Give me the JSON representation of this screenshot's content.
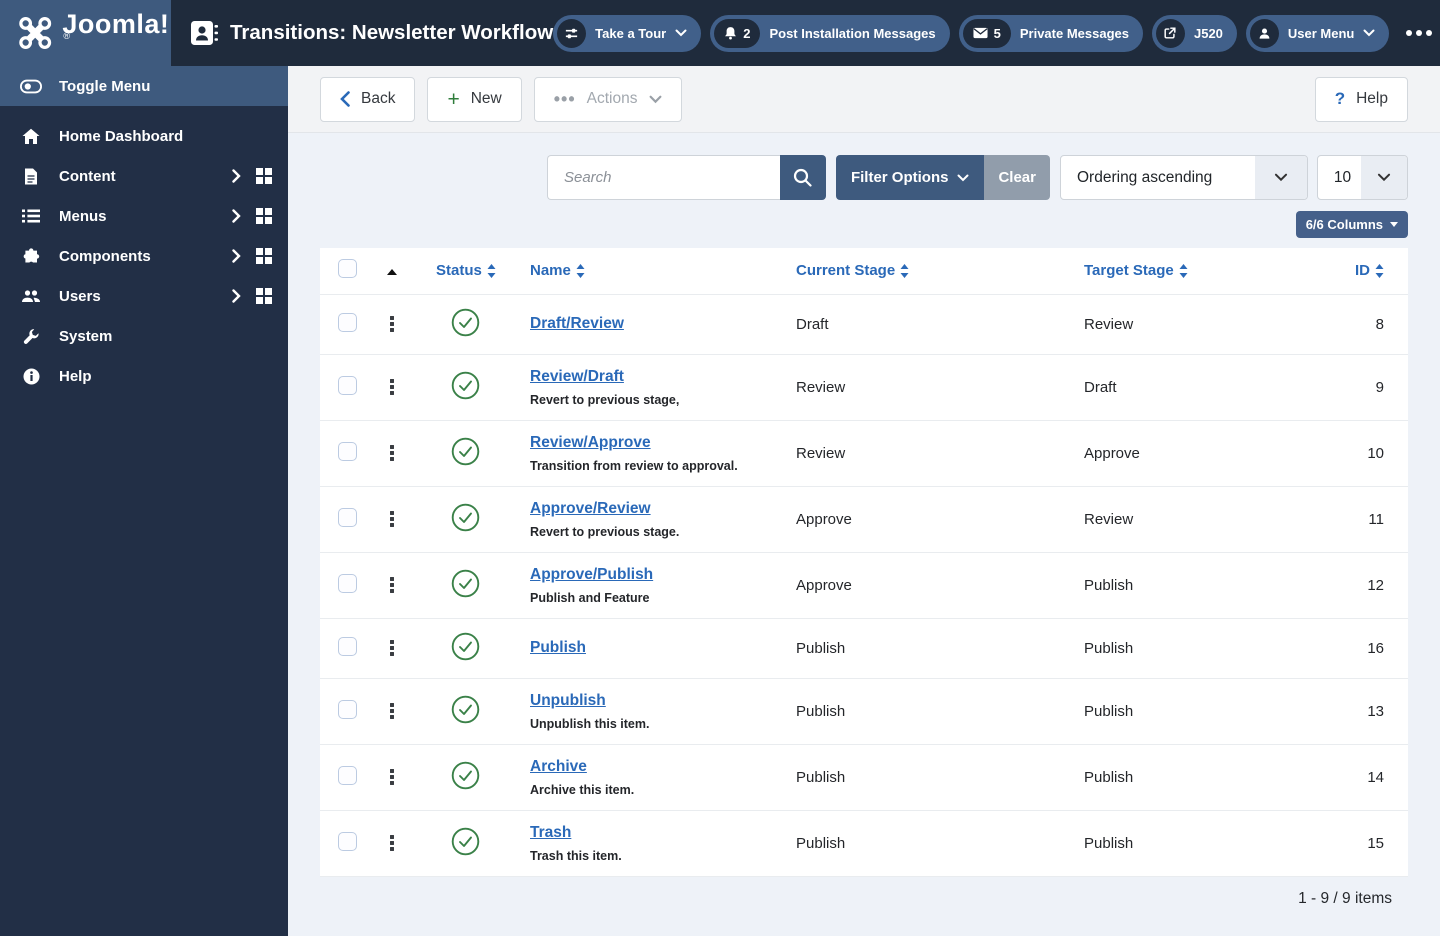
{
  "colors": {
    "header_navy": "#1f2b3c",
    "sidebar_navy": "#222f46",
    "steel_blue": "#3e5a7e",
    "accent_link_blue": "#2a69b8",
    "success_green": "#3a8148",
    "clear_gray": "#919dab",
    "disabled_text": "#a2a8af"
  },
  "icons": {
    "logo": "joomla-logo",
    "title": "address-book-icon",
    "tour": "sliders-icon",
    "messages": "bell-icon",
    "private": "envelope-icon",
    "version": "external-link-icon",
    "user": "user-icon",
    "overflow": "ellipsis-icon",
    "search": "magnifier-icon",
    "status_ok": "check-circle-icon"
  },
  "header": {
    "logo_text": "Joomla!",
    "logo_reg": "®",
    "page_title": "Transitions: Newsletter Workflow",
    "pills": [
      {
        "label": "Take a Tour"
      },
      {
        "count": "2",
        "label": "Post Installation Messages"
      },
      {
        "count": "5",
        "label": "Private Messages"
      },
      {
        "label": "J520"
      },
      {
        "label": "User Menu"
      }
    ]
  },
  "sidebar": {
    "toggle_label": "Toggle Menu",
    "items": [
      {
        "label": "Home Dashboard"
      },
      {
        "label": "Content"
      },
      {
        "label": "Menus"
      },
      {
        "label": "Components"
      },
      {
        "label": "Users"
      },
      {
        "label": "System"
      },
      {
        "label": "Help"
      }
    ]
  },
  "toolbar": {
    "back_label": "Back",
    "new_label": "New",
    "actions_label": "Actions",
    "help_label": "Help"
  },
  "filters": {
    "search_placeholder": "Search",
    "filter_options_label": "Filter Options",
    "clear_label": "Clear",
    "ordering_value": "Ordering ascending",
    "page_size_value": "10",
    "columns_badge": "6/6 Columns"
  },
  "table": {
    "headers": {
      "status": "Status",
      "name": "Name",
      "current": "Current Stage",
      "target": "Target Stage",
      "id": "ID"
    },
    "rows": [
      {
        "name": "Draft/Review",
        "desc": "",
        "current": "Draft",
        "target": "Review",
        "id": "8"
      },
      {
        "name": "Review/Draft",
        "desc": "Revert to previous stage,",
        "current": "Review",
        "target": "Draft",
        "id": "9"
      },
      {
        "name": "Review/Approve",
        "desc": "Transition from review to approval.",
        "current": "Review",
        "target": "Approve",
        "id": "10"
      },
      {
        "name": "Approve/Review",
        "desc": "Revert to previous stage.",
        "current": "Approve",
        "target": "Review",
        "id": "11"
      },
      {
        "name": "Approve/Publish",
        "desc": "Publish and Feature",
        "current": "Approve",
        "target": "Publish",
        "id": "12"
      },
      {
        "name": "Publish",
        "desc": "",
        "current": "Publish",
        "target": "Publish",
        "id": "16"
      },
      {
        "name": "Unpublish",
        "desc": "Unpublish this item.",
        "current": "Publish",
        "target": "Publish",
        "id": "13"
      },
      {
        "name": "Archive",
        "desc": "Archive this item.",
        "current": "Publish",
        "target": "Publish",
        "id": "14"
      },
      {
        "name": "Trash",
        "desc": "Trash this item.",
        "current": "Publish",
        "target": "Publish",
        "id": "15"
      }
    ],
    "footer_count": "1 - 9 / 9 items"
  }
}
